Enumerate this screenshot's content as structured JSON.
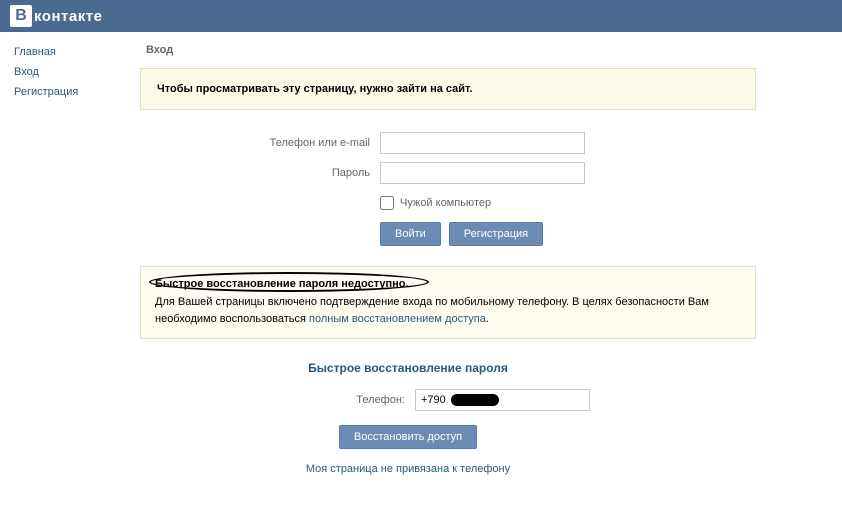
{
  "logo": {
    "icon_letter": "В",
    "text": "контакте"
  },
  "sidebar": {
    "items": [
      {
        "label": "Главная"
      },
      {
        "label": "Вход"
      },
      {
        "label": "Регистрация"
      }
    ]
  },
  "page": {
    "title": "Вход"
  },
  "infobox": {
    "text": "Чтобы просматривать эту страницу, нужно зайти на сайт."
  },
  "login_form": {
    "email_label": "Телефон или e-mail",
    "password_label": "Пароль",
    "foreign_checkbox": "Чужой компьютер",
    "login_button": "Войти",
    "register_button": "Регистрация"
  },
  "warning": {
    "title": "Быстрое восстановление пароля недоступно.",
    "text_before_link": "Для Вашей страницы включено подтверждение входа по мобильному телефону. В целях безопасности Вам необходимо воспользоваться ",
    "link_text": "полным восстановлением доступа",
    "text_after_link": "."
  },
  "recovery": {
    "title": "Быстрое восстановление пароля",
    "phone_label": "Телефон:",
    "phone_value_prefix": "+790",
    "restore_button": "Восстановить доступ",
    "not_linked_link": "Моя страница не привязана к телефону"
  }
}
